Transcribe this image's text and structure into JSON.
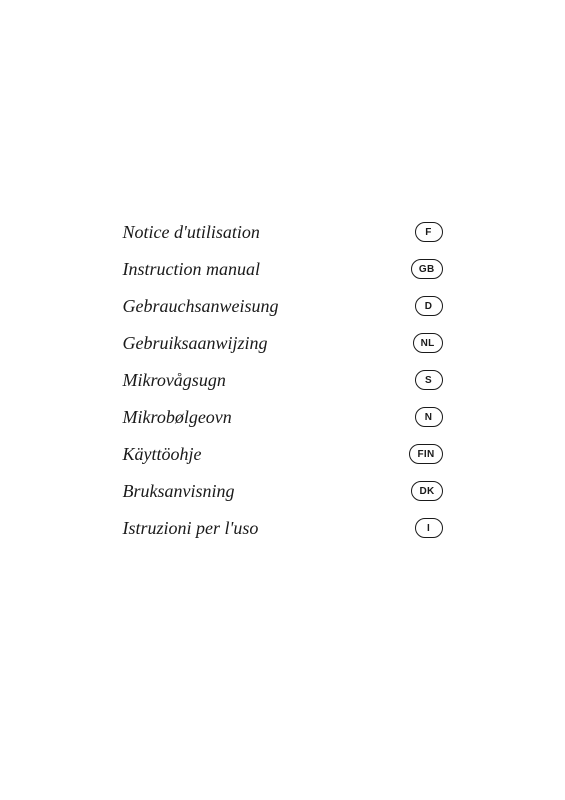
{
  "items": [
    {
      "label": "Notice d'utilisation",
      "badge": "F"
    },
    {
      "label": "Instruction manual",
      "badge": "GB"
    },
    {
      "label": "Gebrauchsanweisung",
      "badge": "D"
    },
    {
      "label": "Gebruiksaanwijzing",
      "badge": "NL"
    },
    {
      "label": "Mikrovågsugn",
      "badge": "S"
    },
    {
      "label": "Mikrobølgeovn",
      "badge": "N"
    },
    {
      "label": "Käyttöohje",
      "badge": "FIN"
    },
    {
      "label": "Bruksanvisning",
      "badge": "DK"
    },
    {
      "label": "Istruzioni per l'uso",
      "badge": "I"
    }
  ]
}
